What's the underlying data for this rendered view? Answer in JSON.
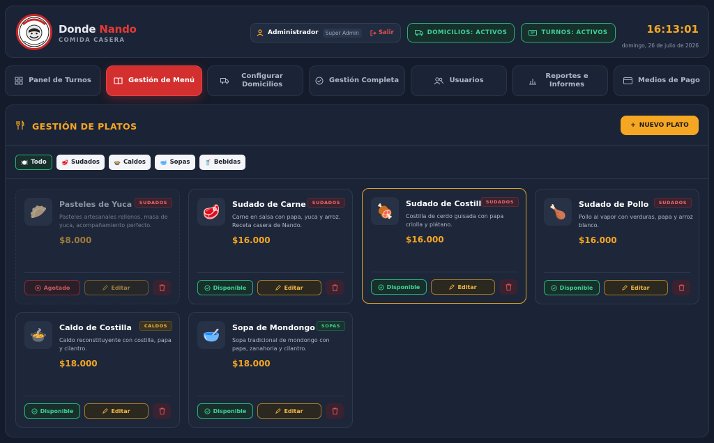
{
  "header": {
    "brand_first": "Donde",
    "brand_accent": "Nando",
    "brand_sub": "COMIDA CASERA",
    "admin_name": "Administrador",
    "admin_role": "Super Admin",
    "logout": "Salir",
    "status_delivery": "DOMICILIOS: ACTIVOS",
    "status_shifts": "TURNOS: ACTIVOS",
    "clock": "16:13:01",
    "date": "domingo, 26 de julio de 2026"
  },
  "nav": [
    {
      "label": "Panel de Turnos",
      "icon": "grid-icon"
    },
    {
      "label": "Gestión de Menú",
      "icon": "book-icon"
    },
    {
      "label": "Configurar Domicilios",
      "icon": "truck-icon"
    },
    {
      "label": "Gestión Completa",
      "icon": "check-circle-icon"
    },
    {
      "label": "Usuarios",
      "icon": "users-icon"
    },
    {
      "label": "Reportes e Informes",
      "icon": "bar-chart-icon"
    },
    {
      "label": "Medios de Pago",
      "icon": "card-icon"
    }
  ],
  "panel": {
    "title": "GESTIÓN DE PLATOS",
    "new_button": "NUEVO PLATO"
  },
  "filters": [
    {
      "label": "Todo",
      "emoji": "🍽️"
    },
    {
      "label": "Sudados",
      "emoji": "🥩"
    },
    {
      "label": "Caldos",
      "emoji": "🍲"
    },
    {
      "label": "Sopas",
      "emoji": "🥣"
    },
    {
      "label": "Bebidas",
      "emoji": "🥤"
    }
  ],
  "cards": [
    {
      "name": "Pasteles de Yuca",
      "badge": "SUDADOS",
      "desc": "Pasteles artesanales rellenos, masa de yuca, acompañamiento perfecto.",
      "price": "$8.000",
      "status": "Agotado",
      "edit": "Editar",
      "emoji": "🥟"
    },
    {
      "name": "Sudado de Carne",
      "badge": "SUDADOS",
      "desc": "Carne en salsa con papa, yuca y arroz. Receta casera de Nando.",
      "price": "$16.000",
      "status": "Disponible",
      "edit": "Editar",
      "emoji": "🥩"
    },
    {
      "name": "Sudado de Costilla",
      "badge": "SUDADOS",
      "desc": "Costilla de cerdo guisada con papa criolla y plátano.",
      "price": "$16.000",
      "status": "Disponible",
      "edit": "Editar",
      "emoji": "🍖"
    },
    {
      "name": "Sudado de Pollo",
      "badge": "SUDADOS",
      "desc": "Pollo al vapor con verduras, papa y arroz blanco.",
      "price": "$16.000",
      "status": "Disponible",
      "edit": "Editar",
      "emoji": "🍗"
    },
    {
      "name": "Caldo de Costilla",
      "badge": "CALDOS",
      "desc": "Caldo reconstituyente con costilla, papa y cilantro.",
      "price": "$18.000",
      "status": "Disponible",
      "edit": "Editar",
      "emoji": "🍲"
    },
    {
      "name": "Sopa de Mondongo",
      "badge": "SOPAS",
      "desc": "Sopa tradicional de mondongo con papa, zanahoria y cilantro.",
      "price": "$18.000",
      "status": "Disponible",
      "edit": "Editar",
      "emoji": "🥣"
    }
  ],
  "colors": {
    "accent": "#f5a623",
    "brand_red": "#d32f2f",
    "success": "#2bb07a",
    "bg": "#141b2a"
  }
}
